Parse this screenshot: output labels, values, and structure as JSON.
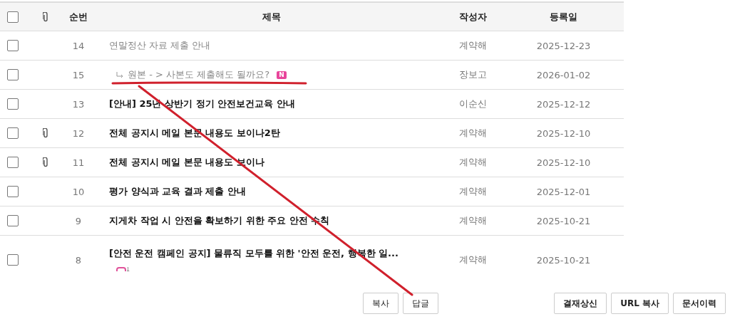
{
  "table": {
    "select_all": {
      "checked": false
    },
    "columns": [
      "순번",
      "제목",
      "작성자",
      "등록일"
    ],
    "rows": [
      {
        "checked": false,
        "attachment": false,
        "number": "14",
        "title": "연말정산 자료 제출 안내",
        "read": true,
        "reply": false,
        "new": false,
        "author": "계약해",
        "date": "2025-12-23"
      },
      {
        "checked": false,
        "attachment": false,
        "number": "15",
        "title": "원본 - > 사본도 제출해도 될까요?",
        "read": true,
        "reply": true,
        "new": true,
        "new_label": "N",
        "author": "장보고",
        "date": "2026-01-02"
      },
      {
        "checked": false,
        "attachment": false,
        "number": "13",
        "title": "[안내] 25년 상반기 정기 안전보건교육 안내",
        "read": false,
        "reply": false,
        "new": false,
        "author": "이순신",
        "date": "2025-12-12"
      },
      {
        "checked": false,
        "attachment": true,
        "number": "12",
        "title": "전체 공지시 메일 본문 내용도 보이나2탄",
        "read": false,
        "reply": false,
        "new": false,
        "author": "계약해",
        "date": "2025-12-10"
      },
      {
        "checked": false,
        "attachment": true,
        "number": "11",
        "title": "전체 공지시 메일 본문 내용도 보이나",
        "read": false,
        "reply": false,
        "new": false,
        "author": "계약해",
        "date": "2025-12-10"
      },
      {
        "checked": false,
        "attachment": false,
        "number": "10",
        "title": "평가 양식과 교육 결과 제출 안내",
        "read": false,
        "reply": false,
        "new": false,
        "author": "계약해",
        "date": "2025-12-01"
      },
      {
        "checked": false,
        "attachment": false,
        "number": "9",
        "title": "지게차 작업 시 안전을 확보하기 위한 주요 안전 수칙",
        "read": false,
        "reply": false,
        "new": false,
        "author": "계약해",
        "date": "2025-10-21"
      },
      {
        "checked": false,
        "attachment": false,
        "number": "8",
        "title": "[안전 운전 캠페인 공지] 물류직 모두를 위한 '안전 운전, 행복한 일...",
        "read": false,
        "reply": false,
        "new": false,
        "comments": "1",
        "author": "계약해",
        "date": "2025-10-21"
      }
    ]
  },
  "left_buttons": [
    "복사",
    "답글"
  ],
  "right_buttons": [
    "결재상신",
    "URL 복사",
    "문서이력"
  ]
}
